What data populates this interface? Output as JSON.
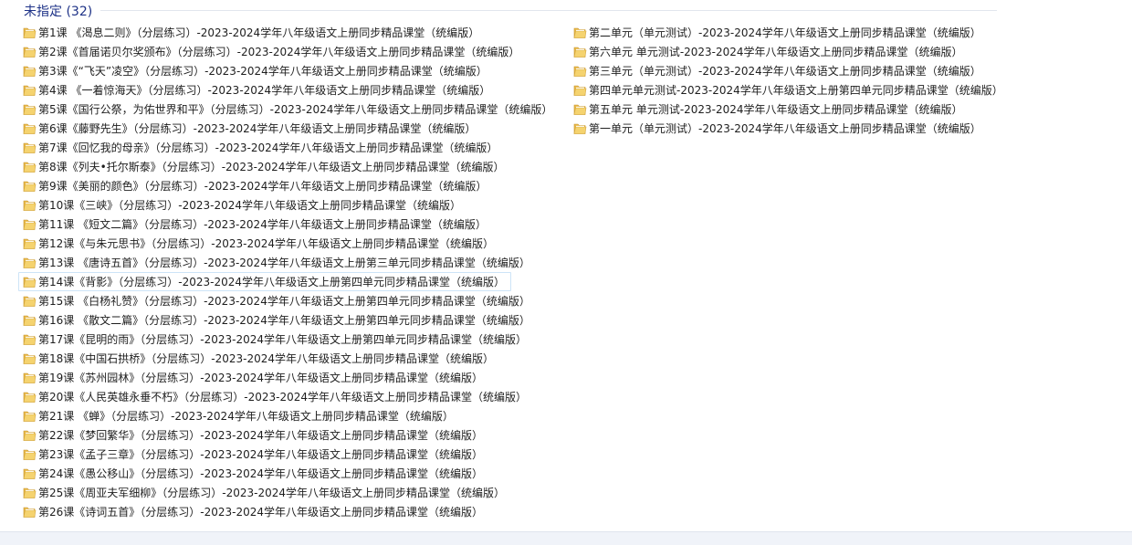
{
  "group": {
    "title": "未指定 (32)"
  },
  "left_items": [
    "第1课 《渴息二则》（分层练习）-2023-2024学年八年级语文上册同步精品课堂（统编版）",
    "第2课《首届诺贝尔奖颁布》（分层练习）-2023-2024学年八年级语文上册同步精品课堂（统编版）",
    "第3课《“飞天”凌空》（分层练习）-2023-2024学年八年级语文上册同步精品课堂（统编版）",
    "第4课 《一着惊海天》（分层练习）-2023-2024学年八年级语文上册同步精品课堂（统编版）",
    "第5课《国行公祭，为佑世界和平》（分层练习）-2023-2024学年八年级语文上册同步精品课堂（统编版）",
    "第6课《藤野先生》（分层练习）-2023-2024学年八年级语文上册同步精品课堂（统编版）",
    "第7课《回忆我的母亲》（分层练习）-2023-2024学年八年级语文上册同步精品课堂（统编版）",
    "第8课《列夫•托尔斯泰》（分层练习）-2023-2024学年八年级语文上册同步精品课堂（统编版）",
    "第9课《美丽的颜色》（分层练习）-2023-2024学年八年级语文上册同步精品课堂（统编版）",
    "第10课《三峡》（分层练习）-2023-2024学年八年级语文上册同步精品课堂（统编版）",
    "第11课 《短文二篇》（分层练习）-2023-2024学年八年级语文上册同步精品课堂（统编版）",
    "第12课《与朱元思书》（分层练习）-2023-2024学年八年级语文上册同步精品课堂（统编版）",
    "第13课 《唐诗五首》（分层练习）-2023-2024学年八年级语文上册第三单元同步精品课堂（统编版）",
    "第14课《背影》（分层练习）-2023-2024学年八年级语文上册第四单元同步精品课堂（统编版）",
    "第15课 《白杨礼赞》（分层练习）-2023-2024学年八年级语文上册第四单元同步精品课堂（统编版）",
    "第16课 《散文二篇》（分层练习）-2023-2024学年八年级语文上册第四单元同步精品课堂（统编版）",
    "第17课《昆明的雨》（分层练习）-2023-2024学年八年级语文上册第四单元同步精品课堂（统编版）",
    "第18课《中国石拱桥》（分层练习）-2023-2024学年八年级语文上册同步精品课堂（统编版）",
    "第19课《苏州园林》（分层练习）-2023-2024学年八年级语文上册同步精品课堂（统编版）",
    "第20课《人民英雄永垂不朽》（分层练习）-2023-2024学年八年级语文上册同步精品课堂（统编版）",
    "第21课 《蝉》（分层练习）-2023-2024学年八年级语文上册同步精品课堂（统编版）",
    "第22课《梦回繁华》（分层练习）-2023-2024学年八年级语文上册同步精品课堂（统编版）",
    "第23课《孟子三章》（分层练习）-2023-2024学年八年级语文上册同步精品课堂（统编版）",
    "第24课《愚公移山》（分层练习）-2023-2024学年八年级语文上册同步精品课堂（统编版）",
    "第25课《周亚夫军细柳》（分层练习）-2023-2024学年八年级语文上册同步精品课堂（统编版）",
    "第26课《诗词五首》（分层练习）-2023-2024学年八年级语文上册同步精品课堂（统编版）"
  ],
  "right_items": [
    "第二单元（单元测试）-2023-2024学年八年级语文上册同步精品课堂（统编版）",
    "第六单元 单元测试-2023-2024学年八年级语文上册同步精品课堂（统编版）",
    "第三单元（单元测试）-2023-2024学年八年级语文上册同步精品课堂（统编版）",
    "第四单元单元测试-2023-2024学年八年级语文上册第四单元同步精品课堂（统编版）",
    "第五单元 单元测试-2023-2024学年八年级语文上册同步精品课堂（统编版）",
    "第一单元（单元测试）-2023-2024学年八年级语文上册同步精品课堂（统编版）"
  ],
  "selected_index": 13,
  "icon": "folder-icon",
  "colors": {
    "group_title": "#1e3287",
    "folder_body": "#e8b84a",
    "folder_front": "#f5d36f",
    "selection_border": "#cde4f7"
  }
}
